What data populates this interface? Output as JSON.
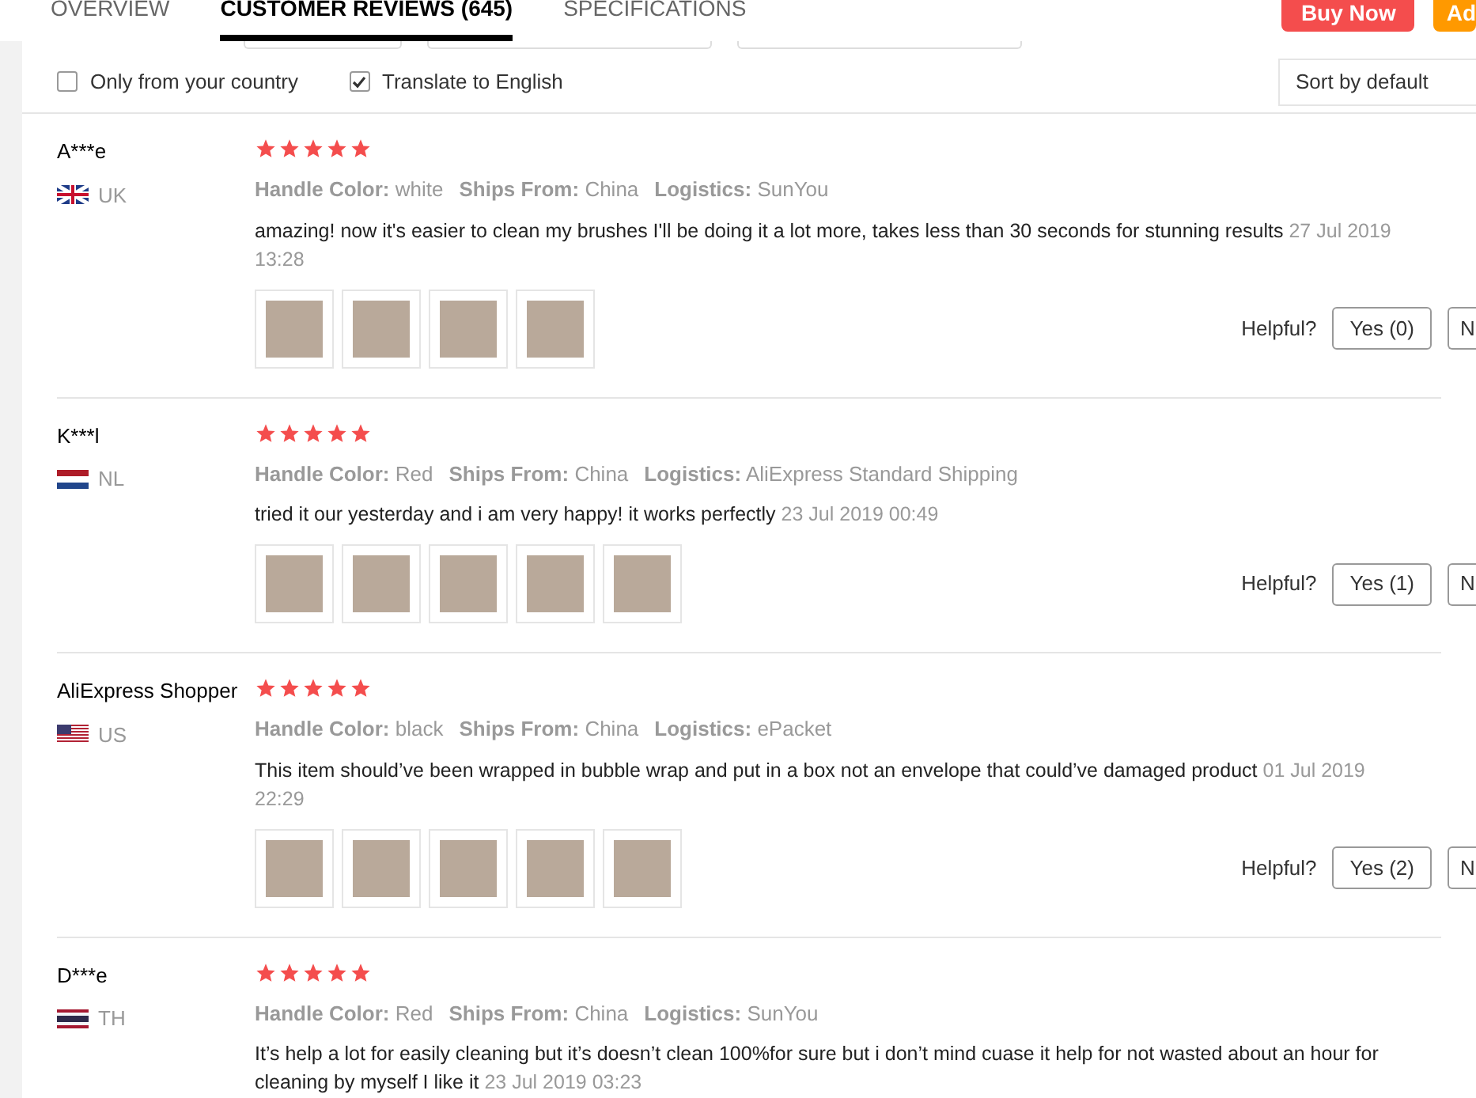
{
  "tabs": [
    {
      "label": "OVERVIEW",
      "selected": false
    },
    {
      "label": "CUSTOMER REVIEWS (645)",
      "selected": true
    },
    {
      "label": "SPECIFICATIONS",
      "selected": false
    }
  ],
  "actions": [
    {
      "label": "Buy Now",
      "kind": "buy"
    },
    {
      "label": "Ad",
      "kind": "cart"
    }
  ],
  "filters": [
    {
      "label": "Only from your country",
      "checked": false
    },
    {
      "label": "Translate to English",
      "checked": true
    }
  ],
  "sort": {
    "value": "Sort by default"
  },
  "reviews": [
    {
      "name": "A***e",
      "country": "UK",
      "stars": 5,
      "attributes": [
        {
          "label": "Handle Color:",
          "value": "white"
        },
        {
          "label": "Ships From:",
          "value": "China"
        },
        {
          "label": "Logistics:",
          "value": "SunYou"
        }
      ],
      "text": "amazing! now it's easier to clean my brushes I'll be doing it a lot more, takes less than 30 seconds for stunning results",
      "date": "27 Jul 2019 13:28",
      "helpful_label": "Helpful?",
      "yes": "Yes (0)",
      "no": "N"
    },
    {
      "name": "K***l",
      "country": "NL",
      "stars": 5,
      "attributes": [
        {
          "label": "Handle Color:",
          "value": "Red"
        },
        {
          "label": "Ships From:",
          "value": "China"
        },
        {
          "label": "Logistics:",
          "value": "AliExpress Standard Shipping"
        }
      ],
      "text": "tried it our yesterday and i am very happy! it works perfectly",
      "date": "23 Jul 2019 00:49",
      "helpful_label": "Helpful?",
      "yes": "Yes (1)",
      "no": "N"
    },
    {
      "name": "AliExpress Shopper",
      "country": "US",
      "stars": 5,
      "attributes": [
        {
          "label": "Handle Color:",
          "value": "black"
        },
        {
          "label": "Ships From:",
          "value": "China"
        },
        {
          "label": "Logistics:",
          "value": "ePacket"
        }
      ],
      "text": "This item should’ve been wrapped in bubble wrap and put in a box not an envelope that could’ve damaged product",
      "date": "01 Jul 2019 22:29",
      "helpful_label": "Helpful?",
      "yes": "Yes (2)",
      "no": "N"
    },
    {
      "name": "D***e",
      "country": "TH",
      "stars": 5,
      "attributes": [
        {
          "label": "Handle Color:",
          "value": "Red"
        },
        {
          "label": "Ships From:",
          "value": "China"
        },
        {
          "label": "Logistics:",
          "value": "SunYou"
        }
      ],
      "text": "It’s help a lot for easily cleaning but it’s doesn’t clean 100%for sure but i don’t mind cuase it help for not wasted about an hour for cleaning by myself I like it",
      "date": "23 Jul 2019 03:23"
    }
  ]
}
